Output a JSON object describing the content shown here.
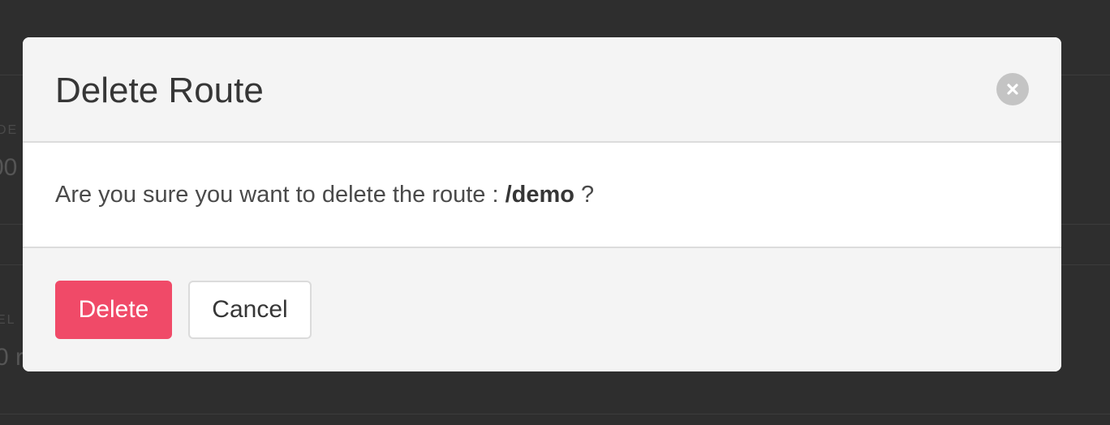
{
  "background": {
    "label_top": "DE",
    "value_top": "00",
    "label_bottom": "EL",
    "value_bottom": "0 r"
  },
  "modal": {
    "title": "Delete Route",
    "close_icon": "close-icon",
    "message_prefix": "Are you sure you want to delete the route : ",
    "route": "/demo",
    "message_suffix": " ?",
    "delete_label": "Delete",
    "cancel_label": "Cancel"
  },
  "colors": {
    "danger": "#f04a68",
    "overlay": "#2e2e2e"
  }
}
